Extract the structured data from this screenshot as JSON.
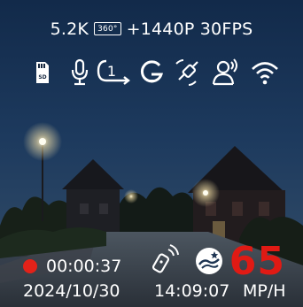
{
  "status_bar": {
    "resolution": "5.2K",
    "mode_badge": "360°",
    "secondary_resolution": "+1440P 30FPS"
  },
  "status_icons": [
    {
      "name": "sd-card-icon",
      "label": "SD"
    },
    {
      "name": "microphone-icon"
    },
    {
      "name": "loop-recording-icon",
      "label": "1"
    },
    {
      "name": "g-sensor-icon"
    },
    {
      "name": "gps-icon"
    },
    {
      "name": "voice-control-icon"
    },
    {
      "name": "wifi-icon"
    }
  ],
  "recording": {
    "indicator_color": "#e32219",
    "elapsed": "00:00:37"
  },
  "bottom_icons": [
    {
      "name": "remote-icon"
    },
    {
      "name": "night-vision-icon"
    }
  ],
  "speed": {
    "value": "65",
    "unit": "MP/H",
    "color": "#e01a14"
  },
  "date": "2024/10/30",
  "time": "14:09:07"
}
